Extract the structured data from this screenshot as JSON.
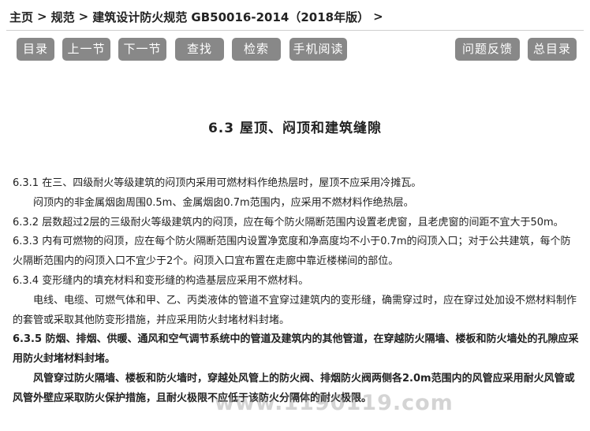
{
  "breadcrumb": {
    "home": "主页",
    "category": "规范",
    "document": "建筑设计防火规范 GB50016-2014（2018年版）",
    "separator": ">",
    "trailing": ">"
  },
  "toolbar": {
    "toc": "目录",
    "prev": "上一节",
    "next": "下一节",
    "find": "查找",
    "search": "检索",
    "mobile": "手机阅读",
    "feedback": "问题反馈",
    "master_toc": "总目录"
  },
  "section": {
    "title": "6.3 屋顶、闷顶和建筑缝隙"
  },
  "paragraphs": [
    "6.3.1 在三、四级耐火等级建筑的闷顶内采用可燃材料作绝热层时，屋顶不应采用冷摊瓦。",
    "闷顶内的非金属烟囱周围0.5m、金属烟囱0.7m范围内，应采用不燃材料作绝热层。",
    "6.3.2 层数超过2层的三级耐火等级建筑内的闷顶，应在每个防火隔断范围内设置老虎窗，且老虎窗的间距不宜大于50m。",
    "6.3.3 内有可燃物的闷顶，应在每个防火隔断范围内设置净宽度和净高度均不小于0.7m的闷顶入口；对于公共建筑，每个防火隔断范围内的闷顶入口不宜少于2个。闷顶入口宜布置在走廊中靠近楼梯间的部位。",
    "6.3.4 变形缝内的填充材料和变形缝的构造基层应采用不燃材料。",
    "电线、电缆、可燃气体和甲、乙、丙类液体的管道不宜穿过建筑内的变形缝，确需穿过时，应在穿过处加设不燃材料制作的套管或采取其他防变形措施，并应采用防火封堵材料封堵。",
    "6.3.5 防烟、排烟、供暖、通风和空气调节系统中的管道及建筑内的其他管道，在穿越防火隔墙、楼板和防火墙处的孔隙应采用防火封堵材料封堵。",
    "风管穿过防火隔墙、楼板和防火墙时，穿越处风管上的防火阀、排烟防火阀两侧各2.0m范围内的风管应采用耐火风管或风管外壁应采取防火保护措施，且耐火极限不应低于该防火分隔体的耐火极限。"
  ],
  "watermark": "www.1190119.com"
}
